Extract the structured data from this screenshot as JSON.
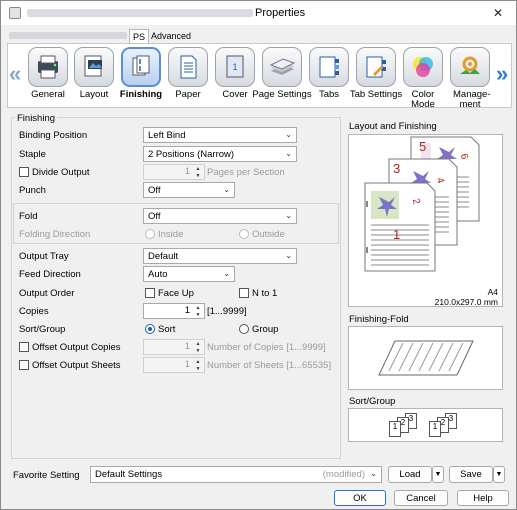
{
  "window": {
    "title_prefix_redacted": true,
    "title": "Properties",
    "close_glyph": "✕"
  },
  "top_tabs": [
    "PS",
    "Advanced"
  ],
  "nav": {
    "items": [
      {
        "label": "General",
        "icon": "printer-settings-icon"
      },
      {
        "label": "Layout",
        "icon": "layout-icon"
      },
      {
        "label": "Finishing",
        "icon": "finishing-icon",
        "selected": true
      },
      {
        "label": "Paper",
        "icon": "paper-icon"
      },
      {
        "label": "Cover",
        "icon": "cover-icon"
      },
      {
        "label": "Page Settings",
        "icon": "page-settings-icon"
      },
      {
        "label": "Tabs",
        "icon": "tabs-icon"
      },
      {
        "label": "Tab Settings",
        "icon": "tab-settings-icon"
      },
      {
        "label": "Color Mode",
        "icon": "color-mode-icon"
      },
      {
        "label": "Manage-ment",
        "icon": "management-icon"
      }
    ],
    "prev_glyph": "«",
    "next_glyph": "»"
  },
  "finishing": {
    "group_label": "Finishing",
    "binding_position": {
      "label": "Binding Position",
      "value": "Left Bind"
    },
    "staple": {
      "label": "Staple",
      "value": "2 Positions (Narrow)"
    },
    "divide_output": {
      "label": "Divide Output",
      "value": "1",
      "unit": "Pages per Section",
      "checked": false
    },
    "punch": {
      "label": "Punch",
      "value": "Off"
    },
    "fold": {
      "label": "Fold",
      "value": "Off"
    },
    "folding_direction": {
      "label": "Folding Direction",
      "inside": "Inside",
      "outside": "Outside"
    },
    "output_tray": {
      "label": "Output Tray",
      "value": "Default"
    },
    "feed_direction": {
      "label": "Feed Direction",
      "value": "Auto"
    },
    "output_order": {
      "label": "Output Order",
      "face_up": "Face Up",
      "n_to_1": "N to 1"
    },
    "copies": {
      "label": "Copies",
      "value": "1",
      "range": "[1...9999]"
    },
    "sort_group": {
      "label": "Sort/Group",
      "sort": "Sort",
      "group": "Group",
      "selected": "Sort"
    },
    "offset_output_copies": {
      "label": "Offset Output Copies",
      "value": "1",
      "hint": "Number of Copies [1...9999]"
    },
    "offset_output_sheets": {
      "label": "Offset Output Sheets",
      "value": "1",
      "hint": "Number of Sheets [1...65535]"
    }
  },
  "preview": {
    "layout_title": "Layout and Finishing",
    "page_numbers": [
      "1",
      "2",
      "3",
      "4",
      "5",
      "6"
    ],
    "paper_size": "A4",
    "paper_dims": "210.0x297.0 mm",
    "fold_title": "Finishing-Fold",
    "sortgroup_title": "Sort/Group",
    "sort_pages": [
      "1",
      "2",
      "3"
    ]
  },
  "favorite": {
    "label": "Favorite Setting",
    "value": "Default Settings",
    "status": "(modified)",
    "load": "Load",
    "save": "Save"
  },
  "footer": {
    "ok": "OK",
    "cancel": "Cancel",
    "help": "Help"
  }
}
